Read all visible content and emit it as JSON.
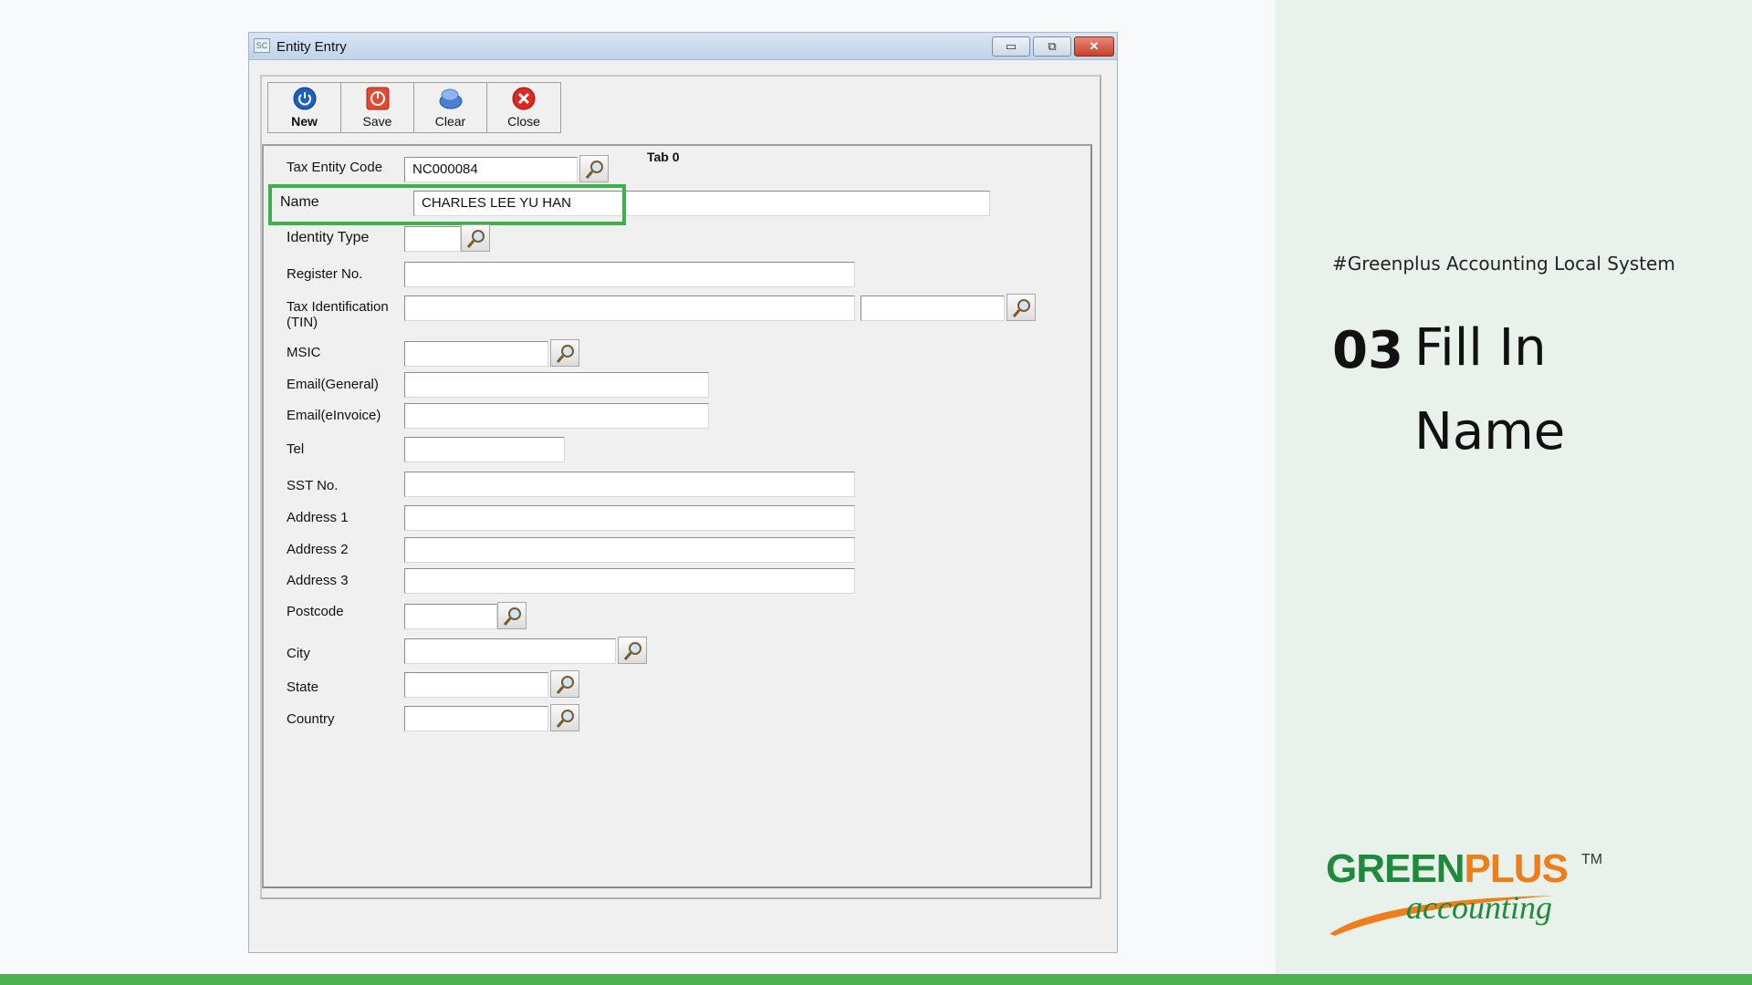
{
  "window": {
    "title": "Entity Entry",
    "icon_text": "SC",
    "controls": {
      "minimize": "▭",
      "maximize": "⧉",
      "close": "✕"
    }
  },
  "toolbar": {
    "new_label": "New",
    "save_label": "Save",
    "clear_label": "Clear",
    "close_label": "Close"
  },
  "tab": {
    "label": "Tab 0"
  },
  "form": {
    "tax_entity_code": {
      "label": "Tax Entity Code",
      "value": "NC000084"
    },
    "name": {
      "label": "Name",
      "value": "CHARLES LEE YU HAN"
    },
    "identity_type": {
      "label": "Identity Type",
      "value": ""
    },
    "register_no": {
      "label": "Register No.",
      "value": ""
    },
    "tin": {
      "label_line1": "Tax Identification",
      "label_line2": "(TIN)",
      "value": "",
      "value2": ""
    },
    "msic": {
      "label": "MSIC",
      "value": ""
    },
    "email_general": {
      "label": "Email(General)",
      "value": ""
    },
    "email_einvoice": {
      "label": "Email(eInvoice)",
      "value": ""
    },
    "tel": {
      "label": "Tel",
      "value": ""
    },
    "sst_no": {
      "label": "SST No.",
      "value": ""
    },
    "address1": {
      "label": "Address 1",
      "value": ""
    },
    "address2": {
      "label": "Address 2",
      "value": ""
    },
    "address3": {
      "label": "Address 3",
      "value": ""
    },
    "postcode": {
      "label": "Postcode",
      "value": ""
    },
    "city": {
      "label": "City",
      "value": ""
    },
    "state": {
      "label": "State",
      "value": ""
    },
    "country": {
      "label": "Country",
      "value": ""
    }
  },
  "side": {
    "hashtag": "#Greenplus Accounting Local System",
    "step_number": "03",
    "step_title": "Fill In Name",
    "logo_green": "GREEN",
    "logo_plus": "PLUS",
    "logo_tm": "TM",
    "logo_sub": "accounting"
  },
  "colors": {
    "highlight": "#3cb14a",
    "brand_green": "#1e8a3c",
    "brand_orange": "#ef7d1a",
    "bottom_bar": "#4caf50"
  }
}
